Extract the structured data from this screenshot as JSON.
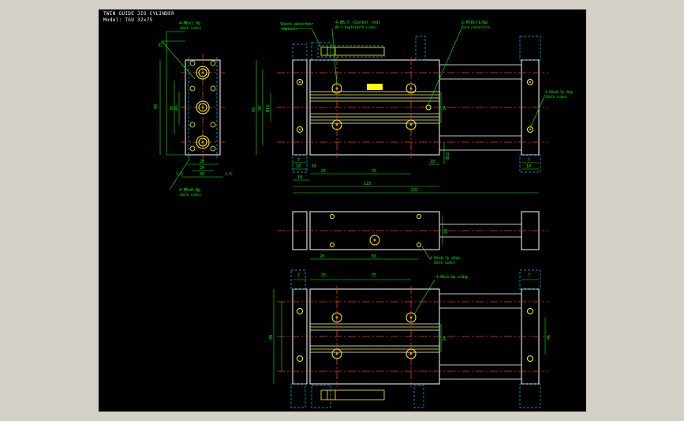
{
  "drawing": {
    "title": "TWIN GUIDE JIG CYLINDER",
    "model": "Model: TGU 32x75"
  },
  "callouts": {
    "c1": "4-M6x1.0p",
    "c1b": "(Both sides)",
    "c2": "4-M6x0.8p",
    "c2b": "(Both sides)",
    "c3": "Shock absorber",
    "c3b": "(Option)",
    "c4": "4-Ø6.5 (Center rod)",
    "c4b": "Ø9.5 Depth(Both sides)",
    "c5": "2-M(Rc)1/8p",
    "c5b": "Port connection",
    "c6": "4-M4x0.7p 8dp",
    "c6b": "(Both sides)",
    "c7": "4-M4x0.7p x8dp.",
    "c7b": "(Both sides)",
    "c8": "4-M6x1.0p x10dp."
  },
  "dims": {
    "side": [
      "75",
      "90",
      "36",
      "46",
      "20",
      "24",
      "38",
      "1.5",
      "1.5"
    ],
    "front": [
      "92",
      "46",
      "Ø13",
      "10",
      "25",
      "75",
      "10",
      "14",
      "7",
      "7",
      "18",
      "123",
      "231",
      "34",
      "Ø12",
      "14"
    ],
    "top": [
      "20",
      "83",
      "28"
    ],
    "bottom": [
      "7",
      "25",
      "75",
      "7",
      "90",
      "34",
      "46"
    ]
  },
  "colors": {
    "background": "#000000",
    "frame": "#d4d0c8",
    "outline": "#ffffff",
    "dimension": "#00ff00",
    "hidden": "#00bfff",
    "center": "#ff3030",
    "holes": "#ffff00",
    "hole_center": "#ff8c00"
  }
}
